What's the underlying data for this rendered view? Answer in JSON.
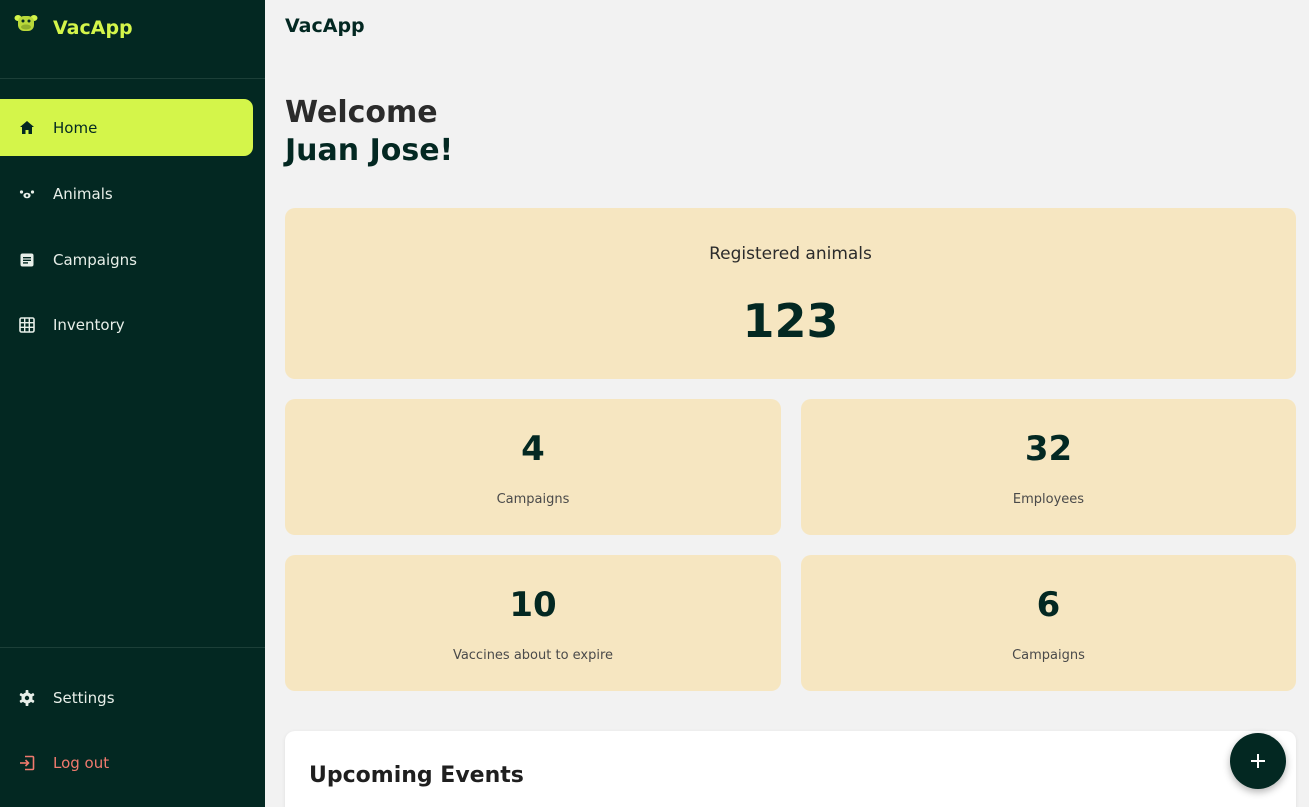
{
  "app": {
    "name": "VacApp",
    "topbar_title": "VacApp"
  },
  "colors": {
    "sidebar_bg": "#032822",
    "accent": "#d4f54a",
    "card_bg": "#f6e6c1",
    "logout": "#f07a6e"
  },
  "sidebar": {
    "items": [
      {
        "label": "Home",
        "icon": "home-icon",
        "active": true
      },
      {
        "label": "Animals",
        "icon": "paw-icon",
        "active": false
      },
      {
        "label": "Campaigns",
        "icon": "document-icon",
        "active": false
      },
      {
        "label": "Inventory",
        "icon": "grid-icon",
        "active": false
      }
    ],
    "bottom_items": [
      {
        "label": "Settings",
        "icon": "gear-icon"
      },
      {
        "label": "Log out",
        "icon": "logout-icon"
      }
    ]
  },
  "welcome": {
    "line1": "Welcome",
    "line2": "Juan Jose!"
  },
  "stats": {
    "main": {
      "label": "Registered animals",
      "value": "123"
    },
    "cards": [
      {
        "value": "4",
        "label": "Campaigns"
      },
      {
        "value": "32",
        "label": "Employees"
      },
      {
        "value": "10",
        "label": "Vaccines about to expire"
      },
      {
        "value": "6",
        "label": "Campaigns"
      }
    ]
  },
  "events": {
    "title": "Upcoming Events"
  },
  "fab": {
    "icon": "plus-icon"
  }
}
